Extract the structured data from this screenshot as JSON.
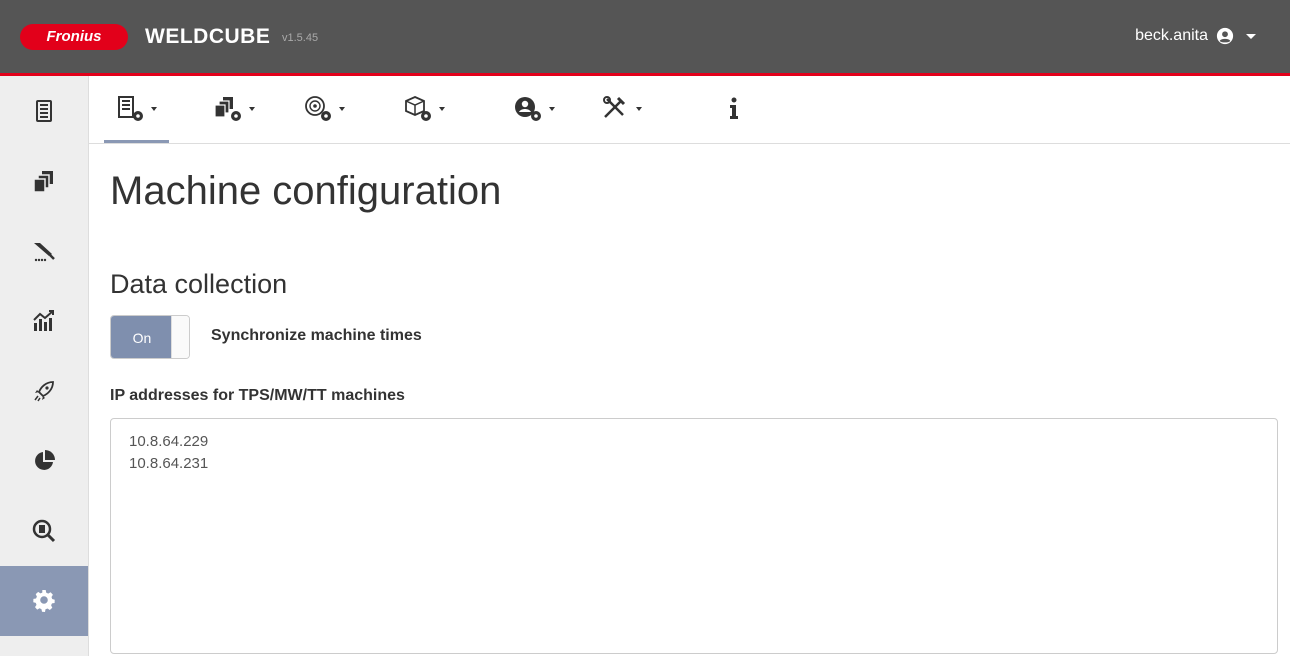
{
  "header": {
    "logo_text": "Fronius",
    "app_name": "WELDCUBE",
    "version": "v1.5.45",
    "username": "beck.anita",
    "accent_color": "#e2001a"
  },
  "sidebar": {
    "items": [
      {
        "icon": "machine-list-icon",
        "active": false
      },
      {
        "icon": "machine-groups-icon",
        "active": false
      },
      {
        "icon": "welding-torch-icon",
        "active": false
      },
      {
        "icon": "analytics-chart-icon",
        "active": false
      },
      {
        "icon": "rocket-icon",
        "active": false
      },
      {
        "icon": "pie-chart-icon",
        "active": false
      },
      {
        "icon": "search-document-icon",
        "active": false
      },
      {
        "icon": "gear-icon",
        "active": true
      }
    ],
    "active_color": "#8a98b4"
  },
  "toolbar": {
    "tabs": [
      {
        "icon": "machine-config-icon",
        "has_dropdown": true,
        "active": true
      },
      {
        "icon": "group-config-icon",
        "has_dropdown": true,
        "active": false
      },
      {
        "icon": "wire-config-icon",
        "has_dropdown": true,
        "active": false
      },
      {
        "icon": "component-config-icon",
        "has_dropdown": true,
        "active": false
      },
      {
        "icon": "user-config-icon",
        "has_dropdown": true,
        "active": false
      },
      {
        "icon": "tools-icon",
        "has_dropdown": true,
        "active": false
      },
      {
        "icon": "info-icon",
        "has_dropdown": false,
        "active": false
      }
    ]
  },
  "main": {
    "title": "Machine configuration",
    "section_title": "Data collection",
    "sync_toggle": {
      "state_label": "On",
      "label": "Synchronize machine times",
      "on": true
    },
    "ip_field": {
      "label": "IP addresses for TPS/MW/TT machines",
      "lines": [
        "10.8.64.229",
        "10.8.64.231"
      ]
    }
  }
}
